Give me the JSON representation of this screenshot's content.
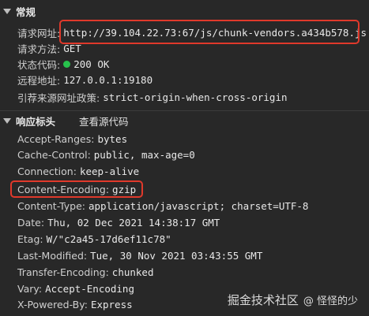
{
  "general": {
    "title": "常规",
    "rows": [
      {
        "key": "请求网址:",
        "value": "http://39.104.22.73:67/js/chunk-vendors.a434b578.js"
      },
      {
        "key": "请求方法:",
        "value": "GET"
      },
      {
        "key": "状态代码:",
        "value": "200 OK"
      },
      {
        "key": "远程地址:",
        "value": "127.0.0.1:19180"
      },
      {
        "key": "引荐来源网址政策:",
        "value": "strict-origin-when-cross-origin"
      }
    ],
    "status_color": "#27c24c"
  },
  "response": {
    "title": "响应标头",
    "view_source_label": "查看源代码",
    "rows": [
      {
        "key": "Accept-Ranges:",
        "value": "bytes"
      },
      {
        "key": "Cache-Control:",
        "value": "public, max-age=0"
      },
      {
        "key": "Connection:",
        "value": "keep-alive"
      },
      {
        "key": "Content-Encoding:",
        "value": "gzip"
      },
      {
        "key": "Content-Type:",
        "value": "application/javascript; charset=UTF-8"
      },
      {
        "key": "Date:",
        "value": "Thu, 02 Dec 2021 14:38:17 GMT"
      },
      {
        "key": "Etag:",
        "value": "W/\"c2a45-17d6ef11c78\""
      },
      {
        "key": "Last-Modified:",
        "value": "Tue, 30 Nov 2021 03:43:55 GMT"
      },
      {
        "key": "Transfer-Encoding:",
        "value": "chunked"
      },
      {
        "key": "Vary:",
        "value": "Accept-Encoding"
      },
      {
        "key": "X-Powered-By:",
        "value": "Express"
      }
    ]
  },
  "watermark": {
    "site": "掘金技术社区",
    "handle": "@ 怪怪的少"
  },
  "highlight_color": "#e0392b"
}
